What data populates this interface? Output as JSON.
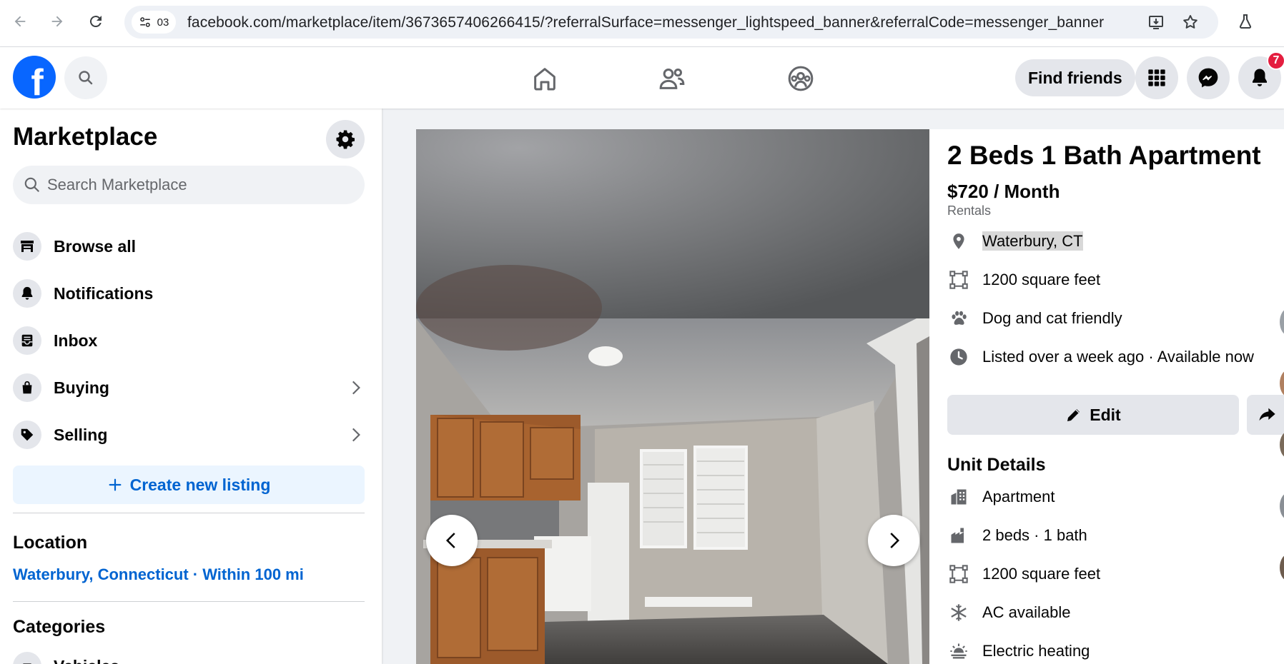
{
  "browser": {
    "site_chip": "03",
    "url": "facebook.com/marketplace/item/3673657406266415/?referralSurface=messenger_lightspeed_banner&referralCode=messenger_banner"
  },
  "header": {
    "find_friends": "Find friends",
    "notification_count": "7",
    "logo_letter": "f"
  },
  "sidebar": {
    "title": "Marketplace",
    "search_placeholder": "Search Marketplace",
    "items": [
      {
        "label": "Browse all",
        "icon": "storefront-icon"
      },
      {
        "label": "Notifications",
        "icon": "bell-icon"
      },
      {
        "label": "Inbox",
        "icon": "inbox-icon"
      },
      {
        "label": "Buying",
        "icon": "shopping-bag-icon"
      },
      {
        "label": "Selling",
        "icon": "tag-icon"
      }
    ],
    "create_listing": "Create new listing",
    "location_heading": "Location",
    "location_value": "Waterbury, Connecticut · Within 100 mi",
    "categories_heading": "Categories",
    "first_category": "Vehicles"
  },
  "listing": {
    "title": "2 Beds 1 Bath Apartment",
    "price": "$720 / Month",
    "category": "Rentals",
    "location": "Waterbury, CT",
    "size": "1200 square feet",
    "pets": "Dog and cat friendly",
    "listed": "Listed over a week ago · Available now",
    "edit_label": "Edit",
    "unit_details_heading": "Unit Details",
    "unit_details": [
      {
        "label": "Apartment",
        "icon": "building-icon"
      },
      {
        "label": "2 beds · 1 bath",
        "icon": "rooms-icon"
      },
      {
        "label": "1200 square feet",
        "icon": "square-footage-icon"
      },
      {
        "label": "AC available",
        "icon": "snowflake-icon"
      },
      {
        "label": "Electric heating",
        "icon": "heating-icon"
      }
    ]
  },
  "colors": {
    "fb_blue": "#0866ff",
    "link_blue": "#0064d1",
    "badge_red": "#e41e3f"
  }
}
